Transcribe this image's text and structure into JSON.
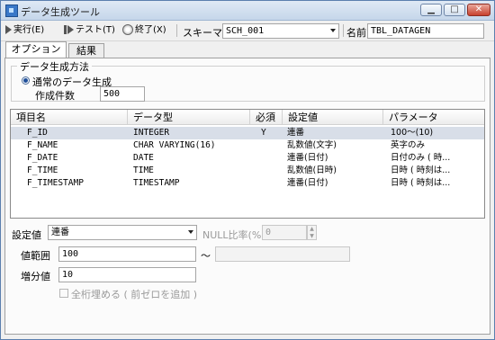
{
  "window": {
    "title": "データ生成ツール",
    "caption_buttons": [
      "minimize",
      "maximize",
      "close"
    ]
  },
  "toolbar": {
    "run_label": "実行(E)",
    "test_label": "テスト(T)",
    "exit_label": "終了(X)",
    "schema_label": "スキーマ",
    "schema_value": "SCH_001",
    "name_label": "名前",
    "name_value": "TBL_DATAGEN"
  },
  "tabs": [
    {
      "label": "オプション",
      "active": true
    },
    {
      "label": "結果",
      "active": false
    }
  ],
  "generation": {
    "group_title": "データ生成方法",
    "radio_label": "通常のデータ生成",
    "radio_selected": true,
    "count_label": "作成件数",
    "count_value": "500"
  },
  "table": {
    "columns": [
      "項目名",
      "データ型",
      "必須",
      "設定値",
      "パラメータ"
    ],
    "rows": [
      {
        "name": "F_ID",
        "type": "INTEGER",
        "required": "Y",
        "setting": "連番",
        "param": "100～(10)",
        "selected": true
      },
      {
        "name": "F_NAME",
        "type": "CHAR VARYING(16)",
        "required": "",
        "setting": "乱数値(文字)",
        "param": "英字のみ",
        "selected": false
      },
      {
        "name": "F_DATE",
        "type": "DATE",
        "required": "",
        "setting": "連番(日付)",
        "param": "日付のみ ( 時...",
        "selected": false
      },
      {
        "name": "F_TIME",
        "type": "TIME",
        "required": "",
        "setting": "乱数値(日時)",
        "param": "日時 ( 時刻は...",
        "selected": false
      },
      {
        "name": "F_TIMESTAMP",
        "type": "TIMESTAMP",
        "required": "",
        "setting": "連番(日付)",
        "param": "日時 ( 時刻は...",
        "selected": false
      }
    ]
  },
  "settings": {
    "setting_label": "設定値",
    "setting_value": "連番",
    "null_ratio_label": "NULL比率(%)",
    "null_ratio_value": "0",
    "range_label": "値範囲",
    "range_from": "100",
    "range_sep": "～",
    "range_to": "",
    "increment_label": "増分値",
    "increment_value": "10",
    "zero_fill_label": "全桁埋める ( 前ゼロを追加 )",
    "zero_fill_checked": false
  },
  "colors": {
    "titlebar": "#c5d6ea",
    "selected_row": "#d8dee8",
    "close_button": "#c8412e"
  }
}
